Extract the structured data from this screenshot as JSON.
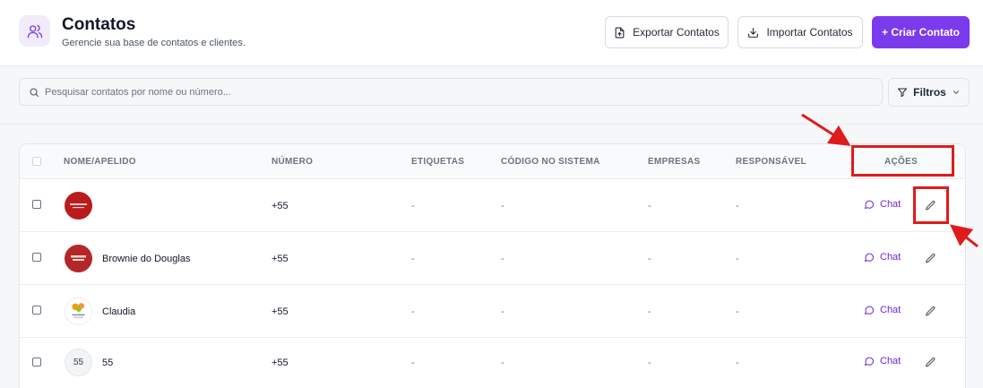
{
  "header": {
    "title": "Contatos",
    "subtitle": "Gerencie sua base de contatos e clientes.",
    "icon": "users-icon",
    "export_label": "Exportar Contatos",
    "import_label": "Importar Contatos",
    "create_label": "+ Criar Contato"
  },
  "search": {
    "placeholder": "Pesquisar contatos por nome ou número...",
    "value": ""
  },
  "filters": {
    "label": "Filtros"
  },
  "table": {
    "columns": [
      "NOME/APELIDO",
      "NÚMERO",
      "ETIQUETAS",
      "CÓDIGO NO SISTEMA",
      "EMPRESAS",
      "RESPONSÁVEL",
      "AÇÕES"
    ],
    "rows": [
      {
        "avatar_text": "",
        "name": "",
        "number": "+55",
        "tags": "-",
        "code": "-",
        "companies": "-",
        "owner": "-",
        "chat": "Chat"
      },
      {
        "avatar_text": "",
        "name": "Brownie do Douglas",
        "number": "+55",
        "tags": "-",
        "code": "-",
        "companies": "-",
        "owner": "-",
        "chat": "Chat"
      },
      {
        "avatar_text": "",
        "name": "Claudia",
        "number": "+55",
        "tags": "-",
        "code": "-",
        "companies": "-",
        "owner": "-",
        "chat": "Chat"
      },
      {
        "avatar_text": "55",
        "name": "55",
        "number": "+55",
        "tags": "-",
        "code": "-",
        "companies": "-",
        "owner": "-",
        "chat": "Chat"
      }
    ]
  },
  "colors": {
    "accent": "#7c3aed",
    "annotation": "#e01b1b"
  }
}
